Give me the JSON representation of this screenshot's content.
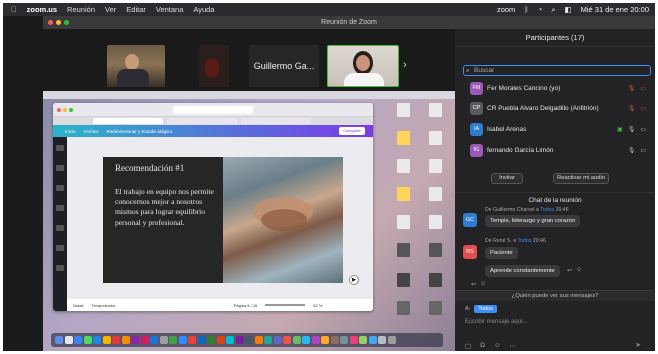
{
  "menubar": {
    "app": "zoom.us",
    "items": [
      "Reunión",
      "Ver",
      "Editar",
      "Ventana",
      "Ayuda"
    ],
    "status_logo": "zoom",
    "clock": "Mié 31 de ene  20:00"
  },
  "window": {
    "title": "Reunión de Zoom"
  },
  "video_strip": {
    "name_tile": "Guillermo Ga...",
    "next_label": "›"
  },
  "shared_screen": {
    "canva_menu": [
      "Inicio",
      "Archivo",
      "Redimensionar y Estudio Mágico"
    ],
    "share_label": "Compartir",
    "slide": {
      "title": "Recomendación #1",
      "body": "El trabajo en equipo nos permite conocernos mejor a nosotros mismos para lograr equilibrio personal y profesional."
    },
    "footer": {
      "notes": "Notas",
      "timer": "Temporizador",
      "page": "Página 8 / 16",
      "zoom": "62 %"
    }
  },
  "participants_panel": {
    "title": "Participantes (17)",
    "search_placeholder": "Buscar",
    "participants": [
      {
        "initials": "FM",
        "name": "Fer Morales Cancino (yo)",
        "color": "#9b59b6"
      },
      {
        "initials": "CP",
        "name": "CR Puebla Alvaro Delgadillo (Anfitrión)",
        "color": "#5a5a5f"
      },
      {
        "initials": "IA",
        "name": "Isabel Arenas",
        "color": "#2e7dd1"
      },
      {
        "initials": "fG",
        "name": "fernando García Limón",
        "color": "#9b59b6"
      }
    ],
    "invite_label": "Invitar",
    "unmute_label": "Reactivar mi audio"
  },
  "chat": {
    "title": "Chat de la reunión",
    "messages": [
      {
        "initials": "GC",
        "avatar_color": "#2e7dd1",
        "from": "De Guillermo Charvel",
        "arrow": "a",
        "to": "Todos",
        "time": "20:46",
        "text": "Temple, liderazgo y gran corazon"
      },
      {
        "initials": "RS",
        "avatar_color": "#e0504f",
        "from": "De René S.",
        "arrow": "a",
        "to": "Todos",
        "time": "20:46",
        "text": "Paciente"
      },
      {
        "text": "Aprende constantemente"
      }
    ],
    "question": "¿Quién puede ver sus mensajes?",
    "to_prefix": "A:",
    "to_value": "Todos",
    "input_placeholder": "Escribir mensaje aquí..."
  }
}
